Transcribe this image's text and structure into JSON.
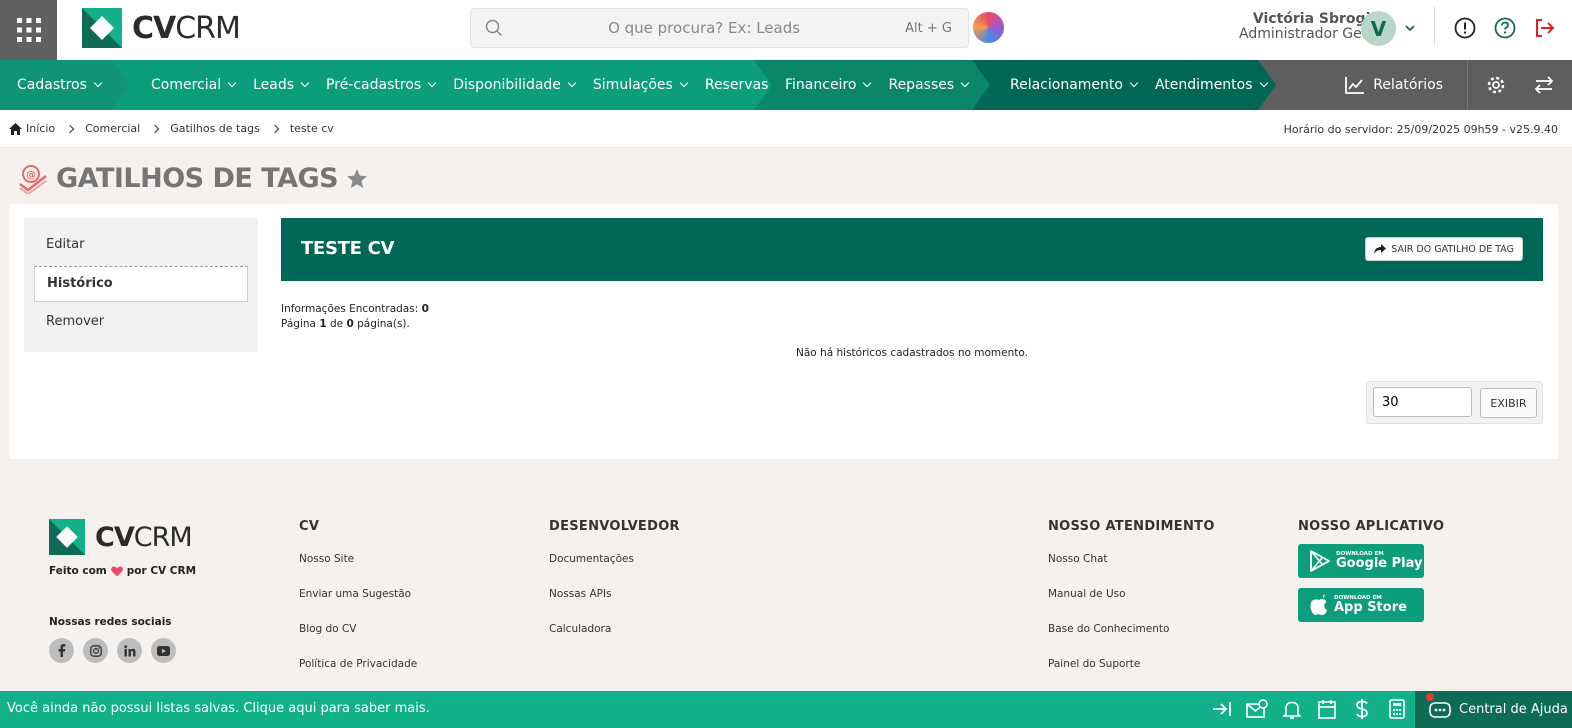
{
  "colors": {
    "brand_dark": "#006655",
    "brand": "#0c9d7c",
    "bottom_bar": "#13b08c",
    "nav_gray": "#5e5e5e",
    "logout_red": "#e02020"
  },
  "brand": {
    "logo_bold": "CV",
    "logo_light": "CRM"
  },
  "search": {
    "placeholder": "O que procura? Ex: Leads",
    "shortcut": "Alt + G"
  },
  "user": {
    "name": "Victória Sbrogio",
    "role": "Administrador Geral",
    "initial": "V"
  },
  "nav": {
    "items": [
      {
        "label": "Cadastros"
      },
      {
        "label": "Comercial"
      },
      {
        "label": "Leads"
      },
      {
        "label": "Pré-cadastros"
      },
      {
        "label": "Disponibilidade"
      },
      {
        "label": "Simulações"
      },
      {
        "label": "Reservas"
      },
      {
        "label": "Financeiro"
      },
      {
        "label": "Repasses"
      },
      {
        "label": "Relacionamento"
      },
      {
        "label": "Atendimentos"
      }
    ],
    "reports": "Relatórios"
  },
  "breadcrumb": {
    "home": "Início",
    "level1": "Comercial",
    "level2": "Gatilhos de tags",
    "current": "teste cv"
  },
  "server_time": "Horário do servidor: 25/09/2025 09h59 - v25.9.40",
  "page_title": "GATILHOS DE TAGS",
  "sidebar": {
    "edit": "Editar",
    "history": "Histórico",
    "remove": "Remover"
  },
  "record": {
    "title": "TESTE CV",
    "exit_button": "SAIR DO GATILHO DE TAG"
  },
  "results": {
    "found_label": "Informações Encontradas:",
    "found_count": "0",
    "page_label": "Página",
    "page_current": "1",
    "page_of": "de",
    "page_total": "0",
    "page_suffix": "página(s).",
    "empty_message": "Não há históricos cadastrados no momento."
  },
  "pager": {
    "per_page": "30",
    "show_button": "EXIBIR"
  },
  "footer": {
    "made_with_prefix": "Feito com",
    "made_with_suffix": "por CV CRM",
    "social_title": "Nossas redes sociais",
    "social": [
      "f",
      "ig",
      "in",
      "yt"
    ],
    "cols": [
      {
        "title": "CV",
        "links": [
          "Nosso Site",
          "Enviar uma Sugestão",
          "Blog do CV",
          "Política de Privacidade"
        ]
      },
      {
        "title": "DESENVOLVEDOR",
        "links": [
          "Documentações",
          "Nossas APIs",
          "Calculadora"
        ]
      },
      {
        "title": "NOSSO ATENDIMENTO",
        "links": [
          "Nosso Chat",
          "Manual de Uso",
          "Base do Conhecimento",
          "Painel do Suporte"
        ]
      },
      {
        "title": "NOSSO APLICATIVO"
      }
    ],
    "google_small": "DOWNLOAD EM",
    "google_big": "Google Play",
    "apple_small": "DOWNLOAD EM",
    "apple_big": "App Store"
  },
  "bottom_bar": {
    "message": "Você ainda não possui listas salvas. Clique aqui para saber mais.",
    "help": "Central de Ajuda"
  }
}
